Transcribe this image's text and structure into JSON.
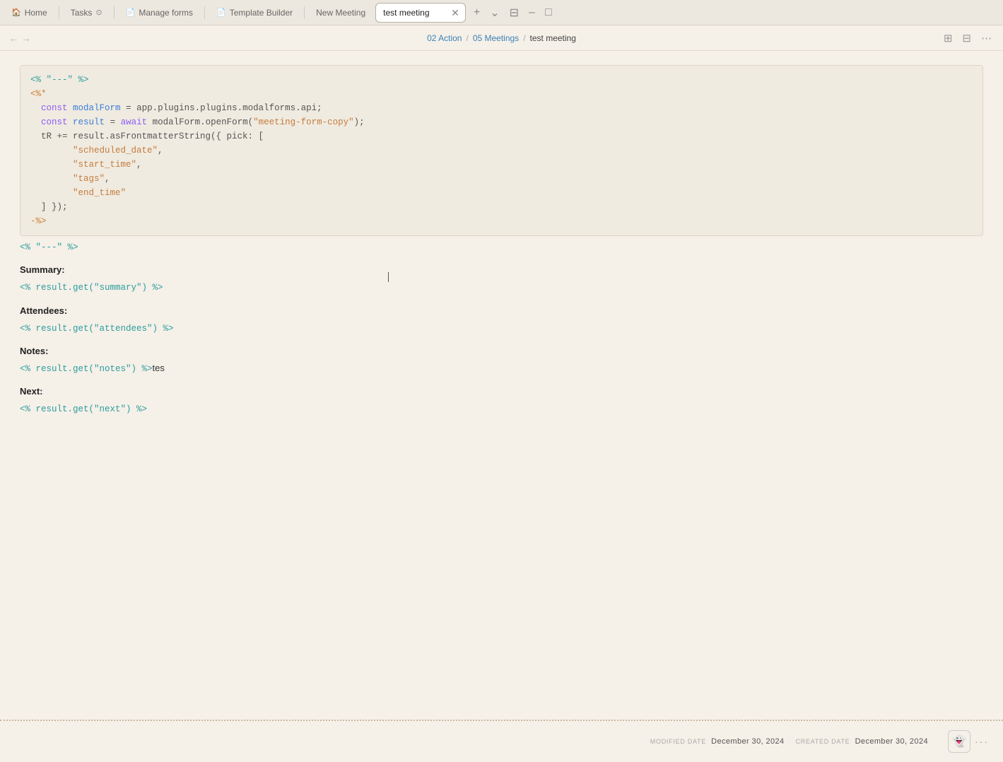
{
  "tabs": [
    {
      "id": "home",
      "label": "Home",
      "icon": "🏠",
      "active": false
    },
    {
      "id": "tasks",
      "label": "Tasks",
      "icon": "📋",
      "active": false
    },
    {
      "id": "manage-forms",
      "label": "Manage forms",
      "icon": "📄",
      "active": false
    },
    {
      "id": "template-builder",
      "label": "Template Builder",
      "icon": "📄",
      "active": false
    },
    {
      "id": "new-meeting",
      "label": "New Meeting",
      "icon": "",
      "active": false
    },
    {
      "id": "test-meeting",
      "label": "test meeting",
      "active": true
    }
  ],
  "breadcrumb": {
    "back": "←",
    "forward": "→",
    "path": [
      {
        "label": "02 Action",
        "link": true
      },
      {
        "label": "05 Meetings",
        "link": true
      },
      {
        "label": "test meeting",
        "link": false
      }
    ],
    "separator": "/"
  },
  "toolbar_right": {
    "split_label": "⊞",
    "layout_label": "⊟",
    "more_label": "⋯"
  },
  "editor": {
    "code_block": {
      "line1": "<% \"---\" %>",
      "line2": "<%*",
      "line3": "  const modalForm = app.plugins.plugins.modalforms.api;",
      "line4": "  const result = await modalForm.openForm(\"meeting-form-copy\");",
      "line5": "  tR += result.asFrontmatterString({ pick: [",
      "line6": "        \"scheduled_date\",",
      "line7": "        \"start_time\",",
      "line8": "        \"tags\",",
      "line9": "        \"end_time\"",
      "line10": "  ] });",
      "line11": "-%>",
      "line12": "<% \"---\" %>"
    },
    "content": [
      {
        "type": "heading",
        "text": "Summary:"
      },
      {
        "type": "tag",
        "text": "<% result.get(\"summary\") %>"
      },
      {
        "type": "spacer"
      },
      {
        "type": "heading",
        "text": "Attendees:"
      },
      {
        "type": "tag",
        "text": "<% result.get(\"attendees\") %>"
      },
      {
        "type": "spacer"
      },
      {
        "type": "heading",
        "text": "Notes:"
      },
      {
        "type": "tag_inline",
        "tag": "<% result.get(\"notes\") %>",
        "suffix": "tes"
      },
      {
        "type": "spacer"
      },
      {
        "type": "heading",
        "text": "Next:"
      },
      {
        "type": "tag",
        "text": "<% result.get(\"next\") %>"
      }
    ]
  },
  "footer": {
    "modified_label": "MODIFIED DATE",
    "modified_date": "December 30, 2024",
    "created_label": "CREATED DATE",
    "created_date": "December 30, 2024",
    "dots": "···"
  }
}
